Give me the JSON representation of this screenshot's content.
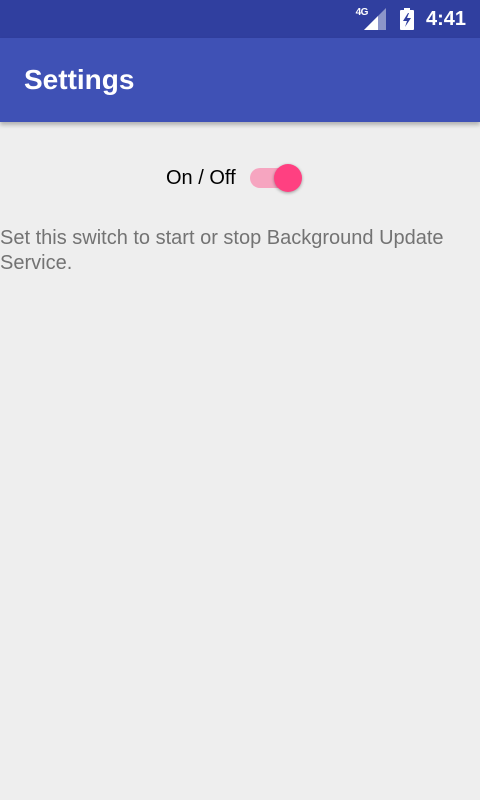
{
  "status_bar": {
    "network_type": "4G",
    "time": "4:41",
    "icons": [
      "signal-icon",
      "battery-charging-icon"
    ]
  },
  "app_bar": {
    "title": "Settings"
  },
  "settings": {
    "switch_label": "On / Off",
    "switch_state": "on",
    "description": "Set this switch to start or stop Background Update Service."
  },
  "colors": {
    "status_bar": "#303f9f",
    "primary": "#3f51b5",
    "accent": "#ff4081",
    "switch_track_on": "#f6a5c0",
    "background": "#eeeeee",
    "description_text": "#737373"
  }
}
